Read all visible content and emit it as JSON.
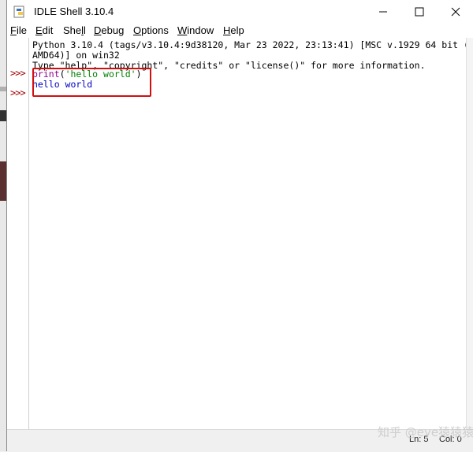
{
  "window": {
    "title": "IDLE Shell 3.10.4",
    "icon": "python-idle-icon"
  },
  "controls": {
    "minimize": "minimize-icon",
    "maximize": "maximize-icon",
    "close": "close-icon"
  },
  "menu": [
    {
      "key": "F",
      "rest": "ile"
    },
    {
      "key": "E",
      "rest": "dit"
    },
    {
      "pre": "She",
      "key": "l",
      "rest": "l"
    },
    {
      "key": "D",
      "rest": "ebug"
    },
    {
      "key": "O",
      "rest": "ptions"
    },
    {
      "key": "W",
      "rest": "indow"
    },
    {
      "key": "H",
      "rest": "elp"
    }
  ],
  "shell": {
    "banner_1": "Python 3.10.4 (tags/v3.10.4:9d38120, Mar 23 2022, 23:13:41) [MSC v.1929 64 bit (",
    "banner_2": "AMD64)] on win32",
    "banner_3": "Type \"help\", \"copyright\", \"credits\" or \"license()\" for more information.",
    "prompt": ">>>",
    "cmd_func": "print",
    "cmd_open": "(",
    "cmd_str": "'hello world'",
    "cmd_close": ")",
    "output": "hello world"
  },
  "status": {
    "line": "Ln: 5",
    "col": "Col: 0"
  },
  "watermark": "知乎 @eye猿猿猿",
  "colors": {
    "prompt": "#a00000",
    "builtin": "#900090",
    "string": "#008000",
    "output": "#0000c0",
    "annotation_box": "#d01010"
  }
}
